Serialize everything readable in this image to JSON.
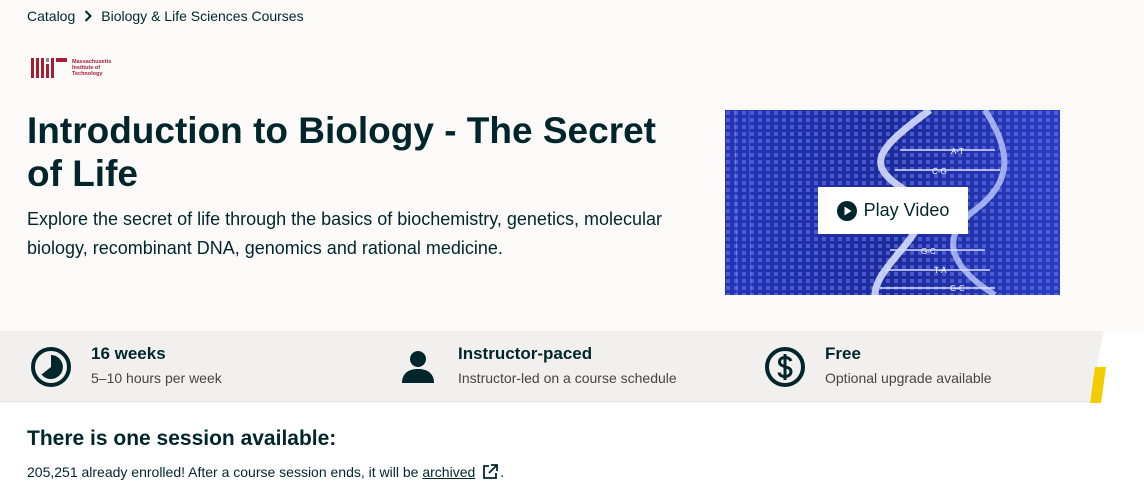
{
  "breadcrumb": {
    "items": [
      "Catalog",
      "Biology & Life Sciences Courses"
    ]
  },
  "logo": {
    "lines": [
      "Massachusetts",
      "Institute of",
      "Technology"
    ]
  },
  "course": {
    "title": "Introduction to Biology - The Secret of Life",
    "description": "Explore the secret of life through the basics of biochemistry, genetics, molecular biology, recombinant DNA, genomics and rational medicine."
  },
  "video": {
    "play_label": "Play Video",
    "helix_labels": [
      "A-T",
      "C-G",
      "G-C",
      "T-A",
      "G-C"
    ]
  },
  "facts": [
    {
      "heading": "16 weeks",
      "sub": "5–10 hours per week",
      "icon": "clock-icon"
    },
    {
      "heading": "Instructor-paced",
      "sub": "Instructor-led on a course schedule",
      "icon": "person-icon"
    },
    {
      "heading": "Free",
      "sub": "Optional upgrade available",
      "icon": "dollar-icon"
    }
  ],
  "session": {
    "title": "There is one session available:",
    "enrolled_text": "205,251 already enrolled! After a course session ends, it will be ",
    "archived_link": "archived",
    "period": "."
  },
  "colors": {
    "text": "#00262b",
    "hero_bg": "#fbfaf9",
    "facts_bg": "#f2f0ef",
    "accent_yellow": "#f0cc00",
    "mit_red": "#a31f34",
    "video_blue": "#1b2a9a"
  }
}
